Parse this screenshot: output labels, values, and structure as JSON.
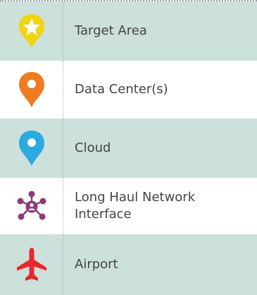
{
  "legend": {
    "items": [
      {
        "label": "Target Area",
        "icon": "star-pin-icon",
        "color": "#f2d40f"
      },
      {
        "label": "Data Center(s)",
        "icon": "map-pin-icon",
        "color": "#f07c22"
      },
      {
        "label": "Cloud",
        "icon": "map-pin-icon",
        "color": "#2baadf"
      },
      {
        "label": "Long Haul Network Interface",
        "icon": "network-hub-icon",
        "color": "#8e3a78"
      },
      {
        "label": "Airport",
        "icon": "airplane-icon",
        "color": "#e8282e"
      }
    ]
  }
}
